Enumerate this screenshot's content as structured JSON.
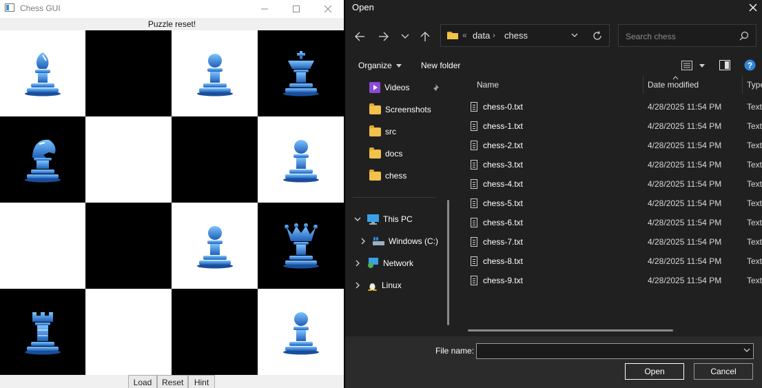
{
  "chess": {
    "title": "Chess GUI",
    "status": "Puzzle reset!",
    "buttons": {
      "load": "Load",
      "reset": "Reset",
      "hint": "Hint"
    },
    "board": [
      [
        "bishop",
        "",
        "pawn",
        "king"
      ],
      [
        "knight",
        "",
        "",
        "pawn"
      ],
      [
        "",
        "",
        "pawn",
        "queen"
      ],
      [
        "rook",
        "",
        "",
        "pawn"
      ]
    ],
    "colors": {
      "light": "#ffffff",
      "dark": "#000000",
      "piece": "#2f86d8"
    }
  },
  "dialog": {
    "title": "Open",
    "breadcrumb": [
      "data",
      "chess"
    ],
    "search_placeholder": "Search chess",
    "toolbar": {
      "organize": "Organize",
      "new_folder": "New folder"
    },
    "nav": {
      "videos": "Videos",
      "screenshots": "Screenshots",
      "src": "src",
      "docs": "docs",
      "chess": "chess",
      "this_pc": "This PC",
      "windows_c": "Windows (C:)",
      "network": "Network",
      "linux": "Linux"
    },
    "columns": {
      "name": "Name",
      "date": "Date modified",
      "type": "Type"
    },
    "files": [
      {
        "name": "chess-0.txt",
        "date": "4/28/2025 11:54 PM",
        "type": "Text"
      },
      {
        "name": "chess-1.txt",
        "date": "4/28/2025 11:54 PM",
        "type": "Text"
      },
      {
        "name": "chess-2.txt",
        "date": "4/28/2025 11:54 PM",
        "type": "Text"
      },
      {
        "name": "chess-3.txt",
        "date": "4/28/2025 11:54 PM",
        "type": "Text"
      },
      {
        "name": "chess-4.txt",
        "date": "4/28/2025 11:54 PM",
        "type": "Text"
      },
      {
        "name": "chess-5.txt",
        "date": "4/28/2025 11:54 PM",
        "type": "Text"
      },
      {
        "name": "chess-6.txt",
        "date": "4/28/2025 11:54 PM",
        "type": "Text"
      },
      {
        "name": "chess-7.txt",
        "date": "4/28/2025 11:54 PM",
        "type": "Text"
      },
      {
        "name": "chess-8.txt",
        "date": "4/28/2025 11:54 PM",
        "type": "Text"
      },
      {
        "name": "chess-9.txt",
        "date": "4/28/2025 11:54 PM",
        "type": "Text"
      }
    ],
    "file_name_label": "File name:",
    "file_name_value": "",
    "open_label": "Open",
    "cancel_label": "Cancel"
  }
}
